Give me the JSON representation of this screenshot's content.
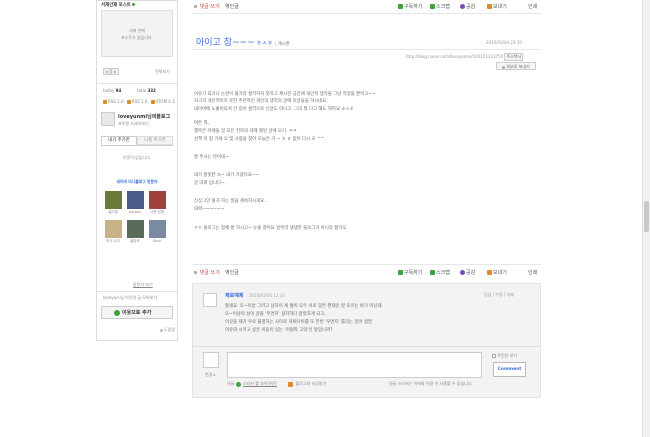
{
  "sidebar": {
    "top_title": "서재안재 포스트",
    "box_text_1": "서재 안에",
    "box_text_2": "포스트가 없습니다.",
    "pager_prev": "◂",
    "pager_next": "▸",
    "pager_more": "전체보기",
    "stats": {
      "today_label": "today",
      "today_value": "94",
      "total_label": "total",
      "total_value": "332"
    },
    "rss_items": [
      "RSS 2.0",
      "RSS 1.0",
      "ATOM 0.3"
    ],
    "blog_name": "loveyunmi님의블로그",
    "blog_desc": "프로필 자세히보기",
    "tabs": [
      "내가 추가한",
      "나를 추가한"
    ],
    "neighbor_empty": "이웃이 없습니다.",
    "visitors_title": "네이버 미니블로그 방문자",
    "visitors": [
      {
        "name": "길티정"
      },
      {
        "name": "dotpos"
      },
      {
        "name": "나준 짐엠"
      },
      {
        "name": "조이 아고"
      },
      {
        "name": "올망조"
      },
      {
        "name": "Dock"
      }
    ],
    "visitors_more": "방문자 보기",
    "owner_text": "loveyun.님 이웃의 글 모아보기",
    "add_button": "이웃으로 추가",
    "footer_link": "도움말"
  },
  "top_actions": {
    "comment_label": "댓글 쓰기",
    "trackback_label": "엮인글",
    "subscribe": "구독하기",
    "scrap": "스크랩",
    "sympathy": "공감",
    "more": "보내기",
    "print": "인쇄"
  },
  "post": {
    "title": "아이고 참~~~",
    "title_suffix": "ㅎㅅㅎ",
    "category": "게시판",
    "date": "2010/03/04 23:39",
    "url": "http://blog.naver.com/loveyunmi/140105333750",
    "copy_label": "주소복사",
    "share_label": "외부로 보내기",
    "body": [
      "이유가 되거나 논란이 될거라 생각하지 못하고 계시한 공간에 개인적 생각을 그냥 적었을 뿐이고~~",
      "지극히 개인적이지 못한 주관적인 개인의 생각의 글에 덧글들을 하시네요.",
      "네이버에 노출이되서 간 있어 생각으로 신글도 아니고..그리 뭐 다고 해도 뭐하요 ㅎㅅㅎ",
      "",
      "여튼 뭐..",
      "행복은 어제들 일 모든 친목의 대해 뭣된 것에 오기. ㅋㅋ",
      "산책 이 형 가세 오 및 사랑을 찾아 오늘은 가 ~ ㅎ ㅎ 없어 다시 오 ^^",
      "",
      "잘 주시는 분이네~",
      "",
      "내가 잘못한 소~ 내가 가겠지요~~",
      "글 대회 입니다~",
      "",
      "신상그만 될거 하는 일을 계속하시게요..",
      "대략~~~~~~",
      "",
      "ㅇㅇ 블로그는 정체 잘 하시고~ 뉴클 결어요 일부러 생생한 블로그가 아니라 할거오."
    ]
  },
  "bottom_actions": {
    "comment_label": "댓글 쓰기",
    "trackback_label": "엮인글",
    "subscribe": "구독하기",
    "scrap": "스크랩",
    "sympathy": "공감",
    "more": "보내기",
    "print": "인쇄"
  },
  "comment": {
    "author": "제로예제",
    "date": "2010/03/04 12:33",
    "reply": "답글",
    "edit": "수정",
    "delete": "삭제",
    "lines": [
      "할새요. 또~이날 그러고 남자이 세 뭘이 모두 서로 맞은 편제인 잘 모르는 바가 아닌데.",
      "또~이남이 성이 글을 '주면지' 걸치하다 갈았하게 되고,",
      "이것을 제가 우로 불평하는 사이로 저쩌나이를 또 한번 '우면지' 를리는 일이 정말",
      "이유와 시키고 싶은 이들이 있는 '이럴락 고의'인 탈입니까?"
    ]
  },
  "comment_form": {
    "secret_label": "주민한 보기",
    "submit": "Comment",
    "info_left": "댓글",
    "sticker_label": "스티커 를 보이려면?",
    "blog_link_label": "블로그와 라공받기",
    "notice": "댓글 스티커는 이에와 이용 수 사용할 수 있습니다."
  },
  "colors": {
    "accent_blue": "#3a6fd8",
    "link_red": "#cc4444",
    "green_icon": "#3aa43a",
    "purple_icon": "#7a4aba",
    "orange_icon": "#e08a2a"
  }
}
